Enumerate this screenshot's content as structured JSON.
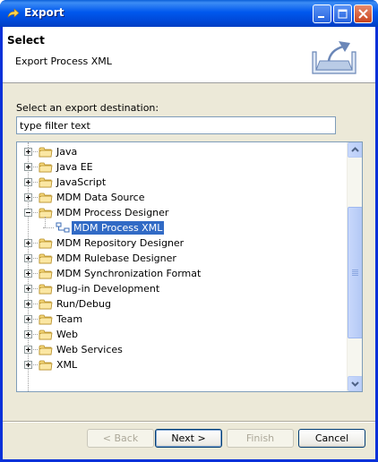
{
  "window": {
    "title": "Export"
  },
  "header": {
    "title": "Select",
    "description": "Export Process XML"
  },
  "destination": {
    "prompt": "Select an export destination:",
    "filter_value": "type filter text"
  },
  "tree": {
    "items": [
      {
        "label": "Java",
        "expanded": false,
        "selected": false
      },
      {
        "label": "Java EE",
        "expanded": false,
        "selected": false
      },
      {
        "label": "JavaScript",
        "expanded": false,
        "selected": false
      },
      {
        "label": "MDM Data Source",
        "expanded": false,
        "selected": false
      },
      {
        "label": "MDM Process Designer",
        "expanded": true,
        "selected": false
      },
      {
        "label": "MDM Process XML",
        "child": true,
        "selected": true
      },
      {
        "label": "MDM Repository Designer",
        "expanded": false,
        "selected": false
      },
      {
        "label": "MDM Rulebase Designer",
        "expanded": false,
        "selected": false
      },
      {
        "label": "MDM Synchronization Format",
        "expanded": false,
        "selected": false
      },
      {
        "label": "Plug-in Development",
        "expanded": false,
        "selected": false
      },
      {
        "label": "Run/Debug",
        "expanded": false,
        "selected": false
      },
      {
        "label": "Team",
        "expanded": false,
        "selected": false
      },
      {
        "label": "Web",
        "expanded": false,
        "selected": false
      },
      {
        "label": "Web Services",
        "expanded": false,
        "selected": false
      },
      {
        "label": "XML",
        "expanded": false,
        "selected": false
      }
    ]
  },
  "buttons": {
    "back": "< Back",
    "next": "Next >",
    "finish": "Finish",
    "cancel": "Cancel"
  },
  "colors": {
    "title_bar": "#0058ee",
    "selection": "#316ac5",
    "folder": "#f5d77a"
  }
}
